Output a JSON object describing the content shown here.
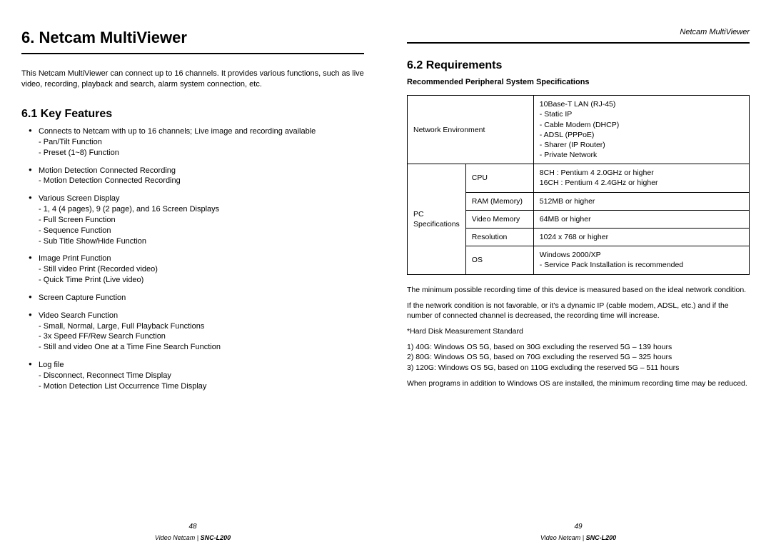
{
  "left": {
    "chapter": "6. Netcam MultiViewer",
    "intro": "This Netcam MultiViewer can connect up to 16 channels. It provides various functions, such as live video, recording, playback and search, alarm system connection, etc.",
    "section": "6.1 Key Features",
    "features": [
      {
        "t": "Connects to Netcam with up to 16 channels; Live image and recording available",
        "s": [
          "Pan/Tilt Function",
          "Preset (1~8) Function"
        ]
      },
      {
        "t": "Motion Detection Connected Recording",
        "s": [
          "Motion Detection Connected Recording"
        ]
      },
      {
        "t": "Various Screen Display",
        "s": [
          "1, 4 (4 pages), 9 (2 page), and 16 Screen Displays",
          "Full Screen Function",
          "Sequence Function",
          "Sub Title Show/Hide Function"
        ]
      },
      {
        "t": "Image Print Function",
        "s": [
          "Still video Print (Recorded video)",
          "Quick Time Print (Live video)"
        ]
      },
      {
        "t": "Screen Capture Function",
        "s": []
      },
      {
        "t": "Video Search Function",
        "s": [
          "Small, Normal, Large, Full Playback Functions",
          "3x Speed FF/Rew Search Function",
          "Still and video One at a Time Fine Search Function"
        ]
      },
      {
        "t": "Log file",
        "s": [
          "Disconnect, Reconnect Time Display",
          "Motion Detection List Occurrence Time Display"
        ]
      }
    ],
    "pn": "48",
    "model_prefix": "Video Netcam | ",
    "model": "SNC-L200"
  },
  "right": {
    "running": "Netcam MultiViewer",
    "section": "6.2 Requirements",
    "subhead": "Recommended Peripheral System Specifications",
    "net_label": "Network Environment",
    "net_items": [
      "10Base-T LAN (RJ-45)",
      "- Static IP",
      "- Cable Modem (DHCP)",
      "- ADSL (PPPoE)",
      "- Sharer (IP Router)",
      "- Private Network"
    ],
    "pc_label": "PC Specifications",
    "pc_rows": [
      {
        "k": "CPU",
        "v": "8CH : Pentium 4 2.0GHz or higher\n16CH : Pentium 4 2.4GHz or higher"
      },
      {
        "k": "RAM (Memory)",
        "v": "512MB or higher"
      },
      {
        "k": "Video Memory",
        "v": "64MB or higher"
      },
      {
        "k": "Resolution",
        "v": "1024 x 768 or higher"
      },
      {
        "k": "OS",
        "v": "Windows 2000/XP\n- Service Pack Installation is recommended"
      }
    ],
    "note1": "The minimum possible recording time of this device is measured based on the ideal network condition.",
    "note2": "If the network condition is not favorable, or it's a dynamic IP (cable modem, ADSL, etc.) and if the number of connected channel is decreased, the recording time will increase.",
    "hd_head": "*Hard Disk Measurement Standard",
    "hd": [
      "1) 40G: Windows OS 5G, based on 30G excluding the reserved 5G – 139 hours",
      "2) 80G: Windows OS 5G, based on 70G excluding the reserved 5G – 325 hours",
      "3) 120G: Windows OS 5G, based on 110G excluding the reserved 5G – 511 hours"
    ],
    "note3": "When programs in addition to Windows OS are installed, the minimum recording time may be reduced.",
    "pn": "49",
    "model_prefix": "Video Netcam | ",
    "model": "SNC-L200"
  }
}
